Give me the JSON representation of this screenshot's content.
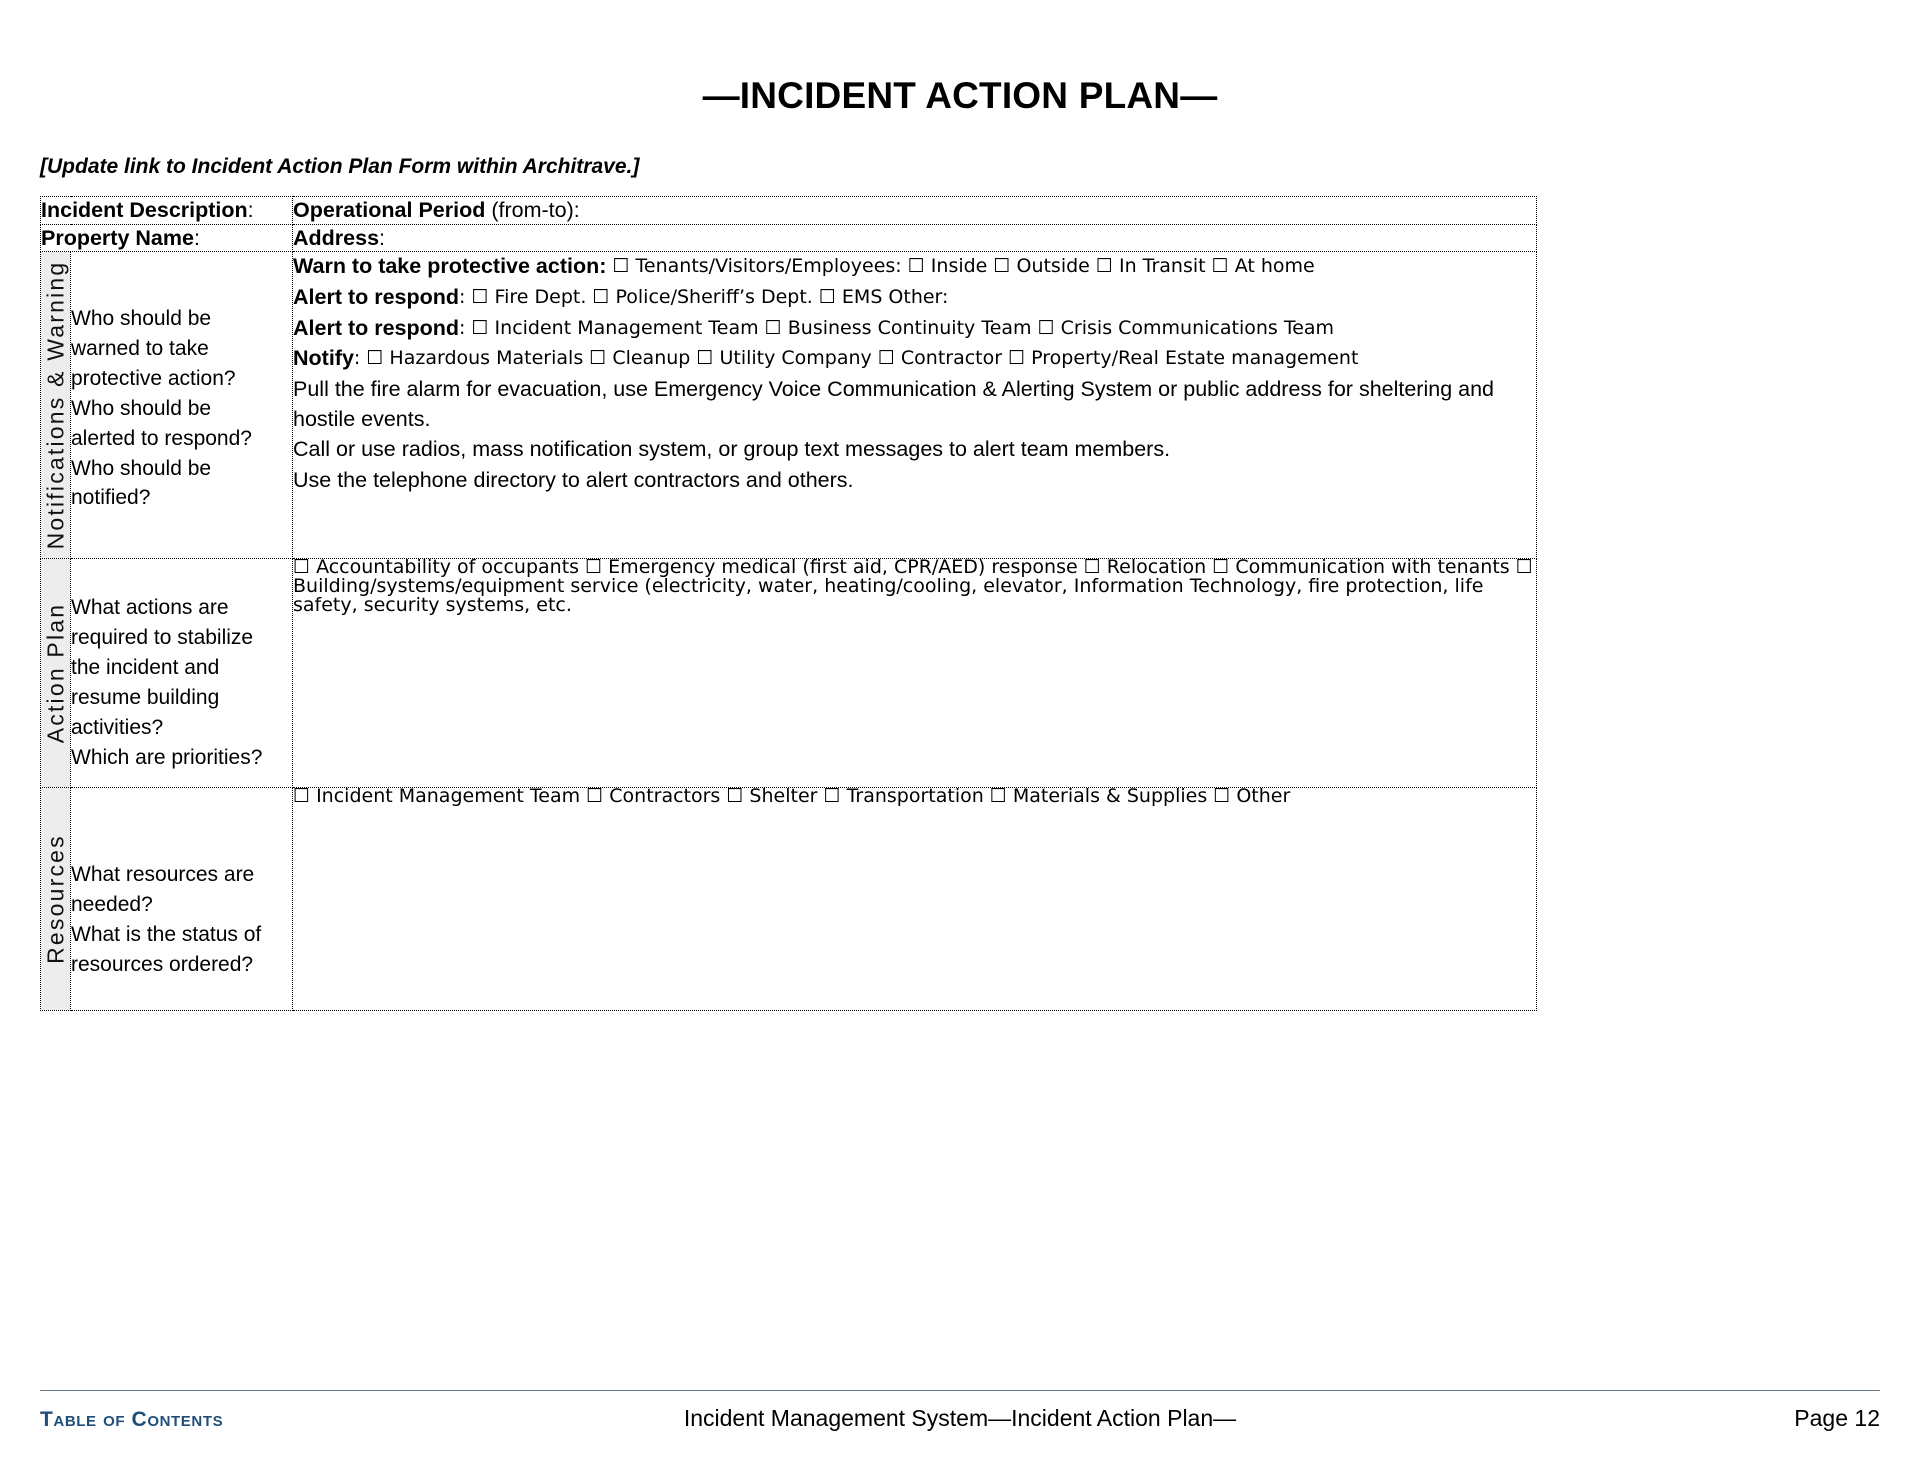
{
  "document": {
    "title": "—INCIDENT ACTION PLAN—",
    "update_note": "[Update link to Incident Action Plan Form within Architrave.]"
  },
  "header_fields": {
    "incident_description_label": "Incident Description",
    "incident_description_suffix": ":",
    "operational_period_label": "Operational Period",
    "operational_period_suffix": " (from-to):",
    "property_name_label": "Property Name",
    "property_name_suffix": ":",
    "address_label": "Address",
    "address_suffix": ":"
  },
  "sections": [
    {
      "side_label": "Notifications & Warning",
      "questions": "Who should be warned to take protective action?\nWho should be alerted to respond?\nWho should be notified?",
      "question_lines": [
        "Who should be",
        "warned to take",
        "protective action?",
        "Who should be",
        "alerted to respond?",
        "Who should be",
        "notified?"
      ],
      "lines": [
        {
          "label": "Warn to take protective action:",
          "rest": " ☐ Tenants/Visitors/Employees: ☐ Inside ☐ Outside ☐ In Transit ☐ At home"
        },
        {
          "label": "Alert to respond",
          "rest": ": ☐ Fire Dept. ☐ Police/Sheriff’s Dept. ☐ EMS Other:"
        },
        {
          "label": "Alert to respond",
          "rest": ": ☐ Incident Management Team ☐ Business Continuity Team ☐ Crisis Communications Team"
        },
        {
          "label": "Notify",
          "rest": ": ☐ Hazardous Materials ☐ Cleanup ☐ Utility Company ☐ Contractor ☐ Property/Real Estate management"
        },
        {
          "label": "",
          "rest": "Pull the fire alarm for evacuation, use Emergency Voice Communication & Alerting System or public address for sheltering and hostile events."
        },
        {
          "label": "",
          "rest": "Call or use radios, mass notification system, or group text messages to alert team members."
        },
        {
          "label": "",
          "rest": "Use the telephone directory to alert contractors and others."
        }
      ]
    },
    {
      "side_label": "Action Plan",
      "question_lines": [
        "What actions are",
        "required to stabilize",
        "the incident and",
        "resume building",
        "activities?",
        "Which are priorities?"
      ],
      "lines": [
        {
          "label": "",
          "rest": "☐ Accountability of occupants ☐ Emergency medical (first aid, CPR/AED) response ☐ Relocation ☐ Communication with tenants ☐ Building/systems/equipment service (electricity, water, heating/cooling, elevator, Information Technology, fire protection, life safety, security systems, etc."
        }
      ]
    },
    {
      "side_label": "Resources",
      "question_lines": [
        "What resources are",
        "needed?",
        "What is the status of",
        "resources ordered?"
      ],
      "lines": [
        {
          "label": "",
          "rest": "☐ Incident Management Team ☐ Contractors ☐ Shelter ☐ Transportation ☐ Materials & Supplies ☐ Other"
        }
      ]
    }
  ],
  "footer": {
    "toc_link": "Table of Contents",
    "center_text": "Incident Management System—Incident Action Plan—",
    "page_label": "Page 12"
  },
  "colors": {
    "toc_link": "#1f4e79",
    "side_label_bg": "#ededed",
    "footer_rule": "#6b7a8c"
  }
}
